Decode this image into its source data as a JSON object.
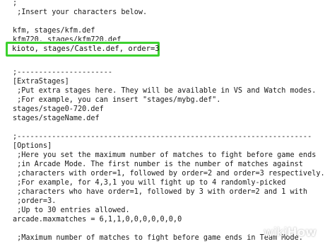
{
  "editor": {
    "lines_top": [
      ";",
      " ;Insert your characters below.",
      "",
      "kfm, stages/kfm.def"
    ],
    "cut_line": "kfm720, stages/kfm720.def",
    "highlighted_line": "kioto, stages/Castle.def, order=3",
    "lines_bottom": [
      "",
      ";----------------------",
      "[ExtraStages]",
      " ;Put extra stages here. They will be available in VS and Watch modes.",
      " ;For example, you can insert \"stages/mybg.def\".",
      "stages/stage0-720.def",
      "stages/stageName.def",
      "",
      ";--------------------------------------------------------------------",
      "[Options]",
      " ;Here you set the maximum number of matches to fight before game ends",
      " ;in Arcade Mode. The first number is the number of matches against",
      " ;characters with order=1, followed by order=2 and order=3 respectively.",
      " ;For example, for 4,3,1 you will fight up to 4 randomly-picked",
      " ;characters who have order=1, followed by 3 with order=2 and 1 with",
      " ;order=3.",
      " ;Up to 30 entries allowed.",
      "arcade.maxmatches = 6,1,1,0,0,0,0,0,0,0",
      "",
      " ;Maximum number of matches to fight before game ends in Team Mode."
    ]
  },
  "highlight": {
    "border_color": "#3cd12e"
  },
  "watermark": {
    "prefix": "wiki",
    "suffix": "How"
  }
}
